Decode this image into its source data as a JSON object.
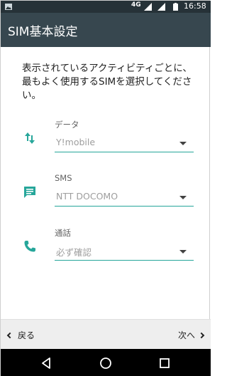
{
  "status_bar": {
    "network": "4G",
    "time": "16:58"
  },
  "app_bar": {
    "title": "SIM基本設定"
  },
  "instructions": "表示されているアクティビティごとに、最もよく使用するSIMを選択してください。",
  "settings": [
    {
      "label": "データ",
      "value": "Y!mobile",
      "icon": "data-transfer-icon"
    },
    {
      "label": "SMS",
      "value": "NTT DOCOMO",
      "icon": "sms-icon"
    },
    {
      "label": "通話",
      "value": "必ず確認",
      "icon": "phone-icon"
    }
  ],
  "footer": {
    "back_label": "戻る",
    "next_label": "次へ"
  },
  "colors": {
    "status_bar": "#263238",
    "app_bar": "#37474f",
    "accent": "#26a69a",
    "footer": "#eeeeee"
  }
}
